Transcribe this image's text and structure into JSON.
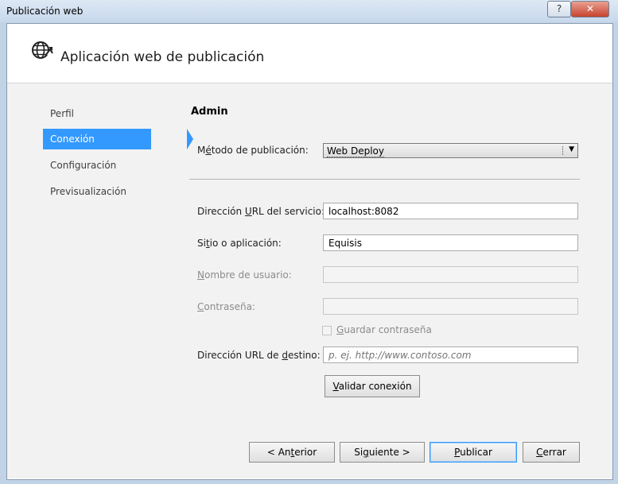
{
  "window": {
    "title": "Publicación web",
    "help_glyph": "?",
    "close_glyph": "✕"
  },
  "header": {
    "title": "Aplicación web de publicación",
    "icon": "globe-publish-icon"
  },
  "nav": {
    "items": [
      {
        "label": "Perfil",
        "active": false
      },
      {
        "label": "Conexión",
        "active": true
      },
      {
        "label": "Configuración",
        "active": false
      },
      {
        "label": "Previsualización",
        "active": false
      }
    ]
  },
  "form": {
    "section_title": "Admin",
    "method": {
      "label_pre": "M",
      "label_acc": "é",
      "label_post": "todo de publicación:",
      "value": "Web Deploy",
      "arrow": "▼"
    },
    "service_url": {
      "label_pre": "Dirección ",
      "label_acc": "U",
      "label_post": "RL del servicio:",
      "value": "localhost:8082"
    },
    "site": {
      "label_pre": "Si",
      "label_acc": "t",
      "label_post": "io o aplicación:",
      "value": "Equisis"
    },
    "username": {
      "label_pre": "",
      "label_acc": "N",
      "label_post": "ombre de usuario:",
      "value": ""
    },
    "password": {
      "label_pre": "",
      "label_acc": "C",
      "label_post": "ontraseña:",
      "value": ""
    },
    "save_password": {
      "label_pre": "",
      "label_acc": "G",
      "label_post": "uardar contraseña",
      "checked": false
    },
    "dest_url": {
      "label_pre": "Dirección URL de ",
      "label_acc": "d",
      "label_post": "estino:",
      "placeholder": "p. ej. http://www.contoso.com"
    },
    "validate": {
      "label_pre": "",
      "label_acc": "V",
      "label_post": "alidar conexión"
    }
  },
  "footer": {
    "prev": {
      "label_pre": "< An",
      "label_acc": "t",
      "label_post": "erior"
    },
    "next": {
      "label_pre": "Si",
      "label_acc": "g",
      "label_post": "uiente >"
    },
    "publish": {
      "label_pre": "",
      "label_acc": "P",
      "label_post": "ublicar"
    },
    "close": {
      "label_pre": "",
      "label_acc": "C",
      "label_post": "errar"
    }
  },
  "colors": {
    "accent": "#3399ff",
    "title_bar": "#c7d8ec",
    "body_bg": "#f2f2f2",
    "close_red": "#c7432e"
  }
}
